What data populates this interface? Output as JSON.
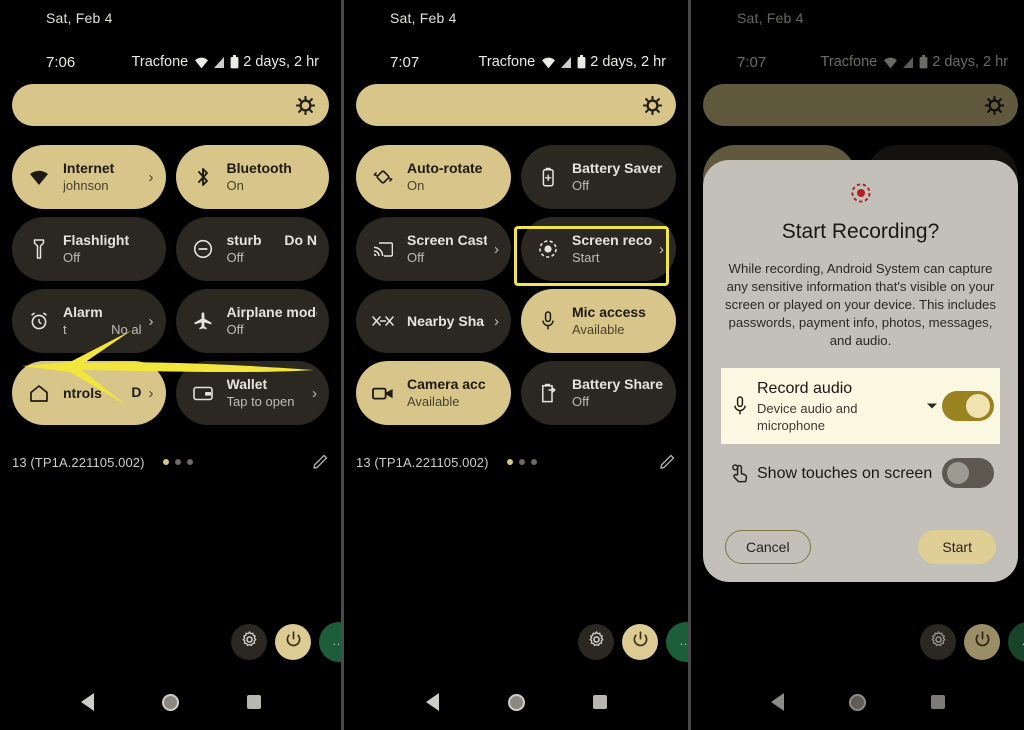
{
  "meta": {
    "accent_tile_on": "#d8c58a",
    "accent_tile_off": "#2b2822",
    "highlight_yellow": "#f0e64a",
    "dialog_bg": "#c3c0ba",
    "record_red": "#b32020"
  },
  "panels": [
    {
      "id": "panel-1",
      "date": "Sat, Feb 4",
      "clock": "7:06",
      "carrier": "Tracfone",
      "battery_text": "2 days, 2 hr",
      "build": "13 (TP1A.221105.002)",
      "page_dots": 3,
      "active_dot": 0,
      "tiles": [
        {
          "name": "internet",
          "title": "Internet",
          "sub": "johnson",
          "on": true,
          "icon": "wifi-icon",
          "chevron": true
        },
        {
          "name": "bluetooth",
          "title": "Bluetooth",
          "sub": "On",
          "on": true,
          "icon": "bluetooth-icon",
          "chevron": false
        },
        {
          "name": "flashlight",
          "title": "Flashlight",
          "sub": "Off",
          "on": false,
          "icon": "flashlight-icon",
          "chevron": false
        },
        {
          "name": "do-not-disturb",
          "title": "sturb",
          "ghost_title": "Do N",
          "sub": "Off",
          "on": false,
          "icon": "do-not-disturb-icon",
          "chevron": false,
          "marquee": true
        },
        {
          "name": "alarm",
          "title": "Alarm",
          "sub": "t",
          "sub_ghost": "No al",
          "on": false,
          "icon": "alarm-icon",
          "chevron": true,
          "marquee": true
        },
        {
          "name": "airplane-mode",
          "title": "Airplane mode",
          "sub": "Off",
          "on": false,
          "icon": "airplane-icon",
          "chevron": false
        },
        {
          "name": "device-controls",
          "title": "ntrols",
          "ghost_title": "D",
          "sub": "",
          "on": true,
          "icon": "home-icon",
          "chevron": true,
          "single": true,
          "marquee": true
        },
        {
          "name": "wallet",
          "title": "Wallet",
          "sub": "Tap to open",
          "on": false,
          "icon": "wallet-icon",
          "chevron": true
        }
      ]
    },
    {
      "id": "panel-2",
      "date": "Sat, Feb 4",
      "clock": "7:07",
      "carrier": "Tracfone",
      "battery_text": "2 days, 2 hr",
      "build": "13 (TP1A.221105.002)",
      "page_dots": 3,
      "active_dot": 0,
      "tiles": [
        {
          "name": "auto-rotate",
          "title": "Auto-rotate",
          "sub": "On",
          "on": true,
          "icon": "auto-rotate-icon",
          "chevron": false
        },
        {
          "name": "battery-saver",
          "title": "Battery Saver",
          "sub": "Off",
          "on": false,
          "icon": "battery-saver-icon",
          "chevron": false
        },
        {
          "name": "screen-cast",
          "title": "Screen Cast",
          "sub": "Off",
          "on": false,
          "icon": "cast-icon",
          "chevron": true
        },
        {
          "name": "screen-record",
          "title": "Screen reco",
          "sub": "Start",
          "on": false,
          "icon": "screen-record-icon",
          "chevron": true,
          "highlighted": true
        },
        {
          "name": "nearby-share",
          "title": "Nearby Sha",
          "sub": "",
          "on": false,
          "icon": "nearby-share-icon",
          "chevron": true,
          "single": true
        },
        {
          "name": "mic-access",
          "title": "Mic access",
          "sub": "Available",
          "on": true,
          "icon": "mic-icon",
          "chevron": false
        },
        {
          "name": "camera-access",
          "title": "Camera acc",
          "sub": "Available",
          "on": true,
          "icon": "camera-icon",
          "chevron": false
        },
        {
          "name": "battery-share",
          "title": "Battery Share",
          "sub": "Off",
          "on": false,
          "icon": "battery-share-icon",
          "chevron": false
        }
      ]
    },
    {
      "id": "panel-3",
      "date": "Sat, Feb 4",
      "clock": "7:07",
      "carrier": "Tracfone",
      "battery_text": "2 days, 2 hr",
      "dimmed": true
    }
  ],
  "dialog": {
    "icon": "screen-record-icon",
    "title": "Start Recording?",
    "body": "While recording, Android System can capture any sensitive information that's visible on your screen or played on your device. This includes passwords, payment info, photos, messages, and audio.",
    "rows": [
      {
        "name": "record-audio",
        "icon": "mic-icon",
        "title": "Record audio",
        "sub": "Device audio and microphone",
        "toggle_on": true,
        "has_caret": true,
        "highlighted": true
      },
      {
        "name": "show-touches",
        "icon": "touch-icon",
        "title": "Show touches on screen",
        "sub": "",
        "toggle_on": false,
        "has_caret": false,
        "highlighted": false
      }
    ],
    "cancel_label": "Cancel",
    "start_label": "Start"
  },
  "bottom_actions": {
    "settings_label": "gear-icon",
    "power_label": "power-icon",
    "avatar_label": "..."
  },
  "navbar": {
    "back_label": "back-icon",
    "home_label": "home-icon",
    "recents_label": "recents-icon"
  },
  "annotation": {
    "type": "arrow",
    "direction": "left",
    "color": "#f2e63c"
  }
}
